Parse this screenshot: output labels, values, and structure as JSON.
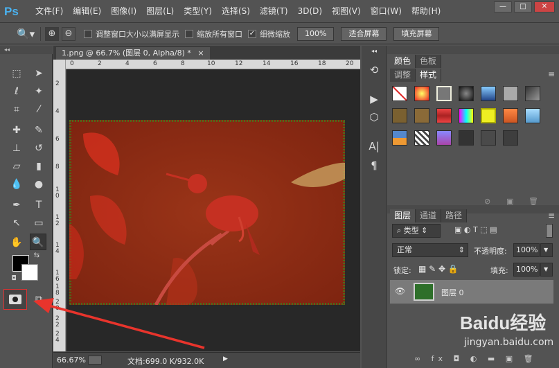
{
  "app": {
    "logo": "Ps"
  },
  "menu": [
    "文件(F)",
    "编辑(E)",
    "图像(I)",
    "图层(L)",
    "类型(Y)",
    "选择(S)",
    "滤镜(T)",
    "3D(D)",
    "视图(V)",
    "窗口(W)",
    "帮助(H)"
  ],
  "window_controls": {
    "minimize": "—",
    "restore": "□",
    "close": "✕"
  },
  "options": {
    "resize_windows": "调整窗口大小以满屏显示",
    "zoom_all": "缩放所有窗口",
    "scrubby_zoom": "细微缩放",
    "zoom_value": "100%",
    "fit_screen": "适合屏幕",
    "fill_screen": "填充屏幕",
    "scrubby_checked": "✓"
  },
  "document": {
    "tab_title": "1.png @ 66.7% (图层 0, Alpha/8) *",
    "tab_close": "×",
    "ruler_h": [
      "0",
      "2",
      "4",
      "6",
      "8",
      "10",
      "12",
      "14",
      "16",
      "18",
      "20"
    ],
    "ruler_v": [
      "2",
      "4",
      "6",
      "8",
      "1\n0",
      "1\n2",
      "1\n4",
      "1\n6",
      "1\n8",
      "2\n0",
      "2\n2",
      "2\n4"
    ],
    "zoom": "66.67%",
    "doc_info": "文档:699.0 K/932.0K"
  },
  "panels": {
    "color_tabs": [
      "颜色",
      "色板"
    ],
    "adjust_tabs": [
      "调整",
      "样式"
    ],
    "layers_tabs": [
      "图层",
      "通道",
      "路径"
    ],
    "filter_kind": "类型",
    "blend_mode": "正常",
    "opacity_label": "不透明度:",
    "opacity_value": "100%",
    "lock_label": "锁定:",
    "fill_label": "填充:",
    "fill_value": "100%",
    "layer_name": "图层 0"
  },
  "watermark": {
    "brand": "Baidu经验",
    "url": "jingyan.baidu.com"
  },
  "colors": {
    "annotation_red": "#e8342c",
    "canvas_red": "#922a12"
  }
}
